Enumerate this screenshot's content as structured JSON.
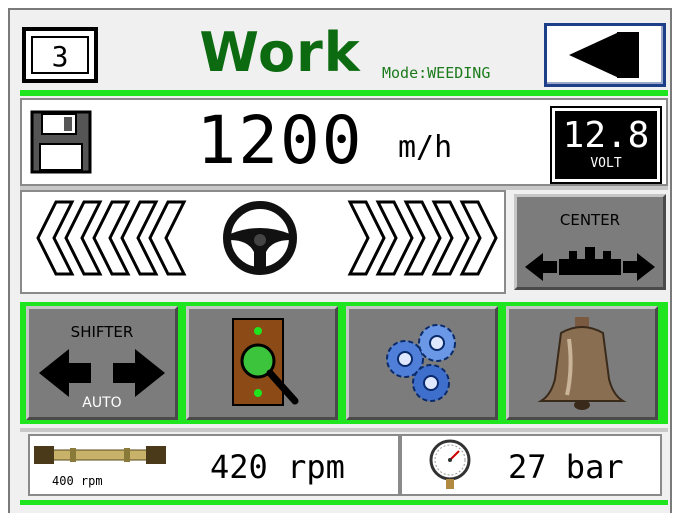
{
  "header": {
    "page_number": "3",
    "title": "Work",
    "mode_text": "Mode:WEEDING",
    "back_icon": "back-arrow-icon"
  },
  "speed": {
    "value": "1200",
    "unit": "m/h",
    "save_icon": "floppy-disk-icon"
  },
  "voltage": {
    "value": "12.8",
    "unit": "VOLT"
  },
  "steering": {
    "center_label": "CENTER",
    "wheel_icon": "steering-wheel-icon"
  },
  "buttons": {
    "shifter_label": "SHIFTER",
    "shifter_mode": "AUTO",
    "inspect_icon": "magnifier-icon",
    "settings_icon": "gears-icon",
    "alarm_icon": "bell-icon"
  },
  "pto": {
    "setpoint": "400 rpm",
    "actual": "420 rpm"
  },
  "pressure": {
    "value": "27 bar",
    "icon": "pressure-gauge-icon"
  },
  "colors": {
    "accent_green": "#1fe51f",
    "title_green": "#0c6b10",
    "button_gray": "#7c7c7c"
  }
}
